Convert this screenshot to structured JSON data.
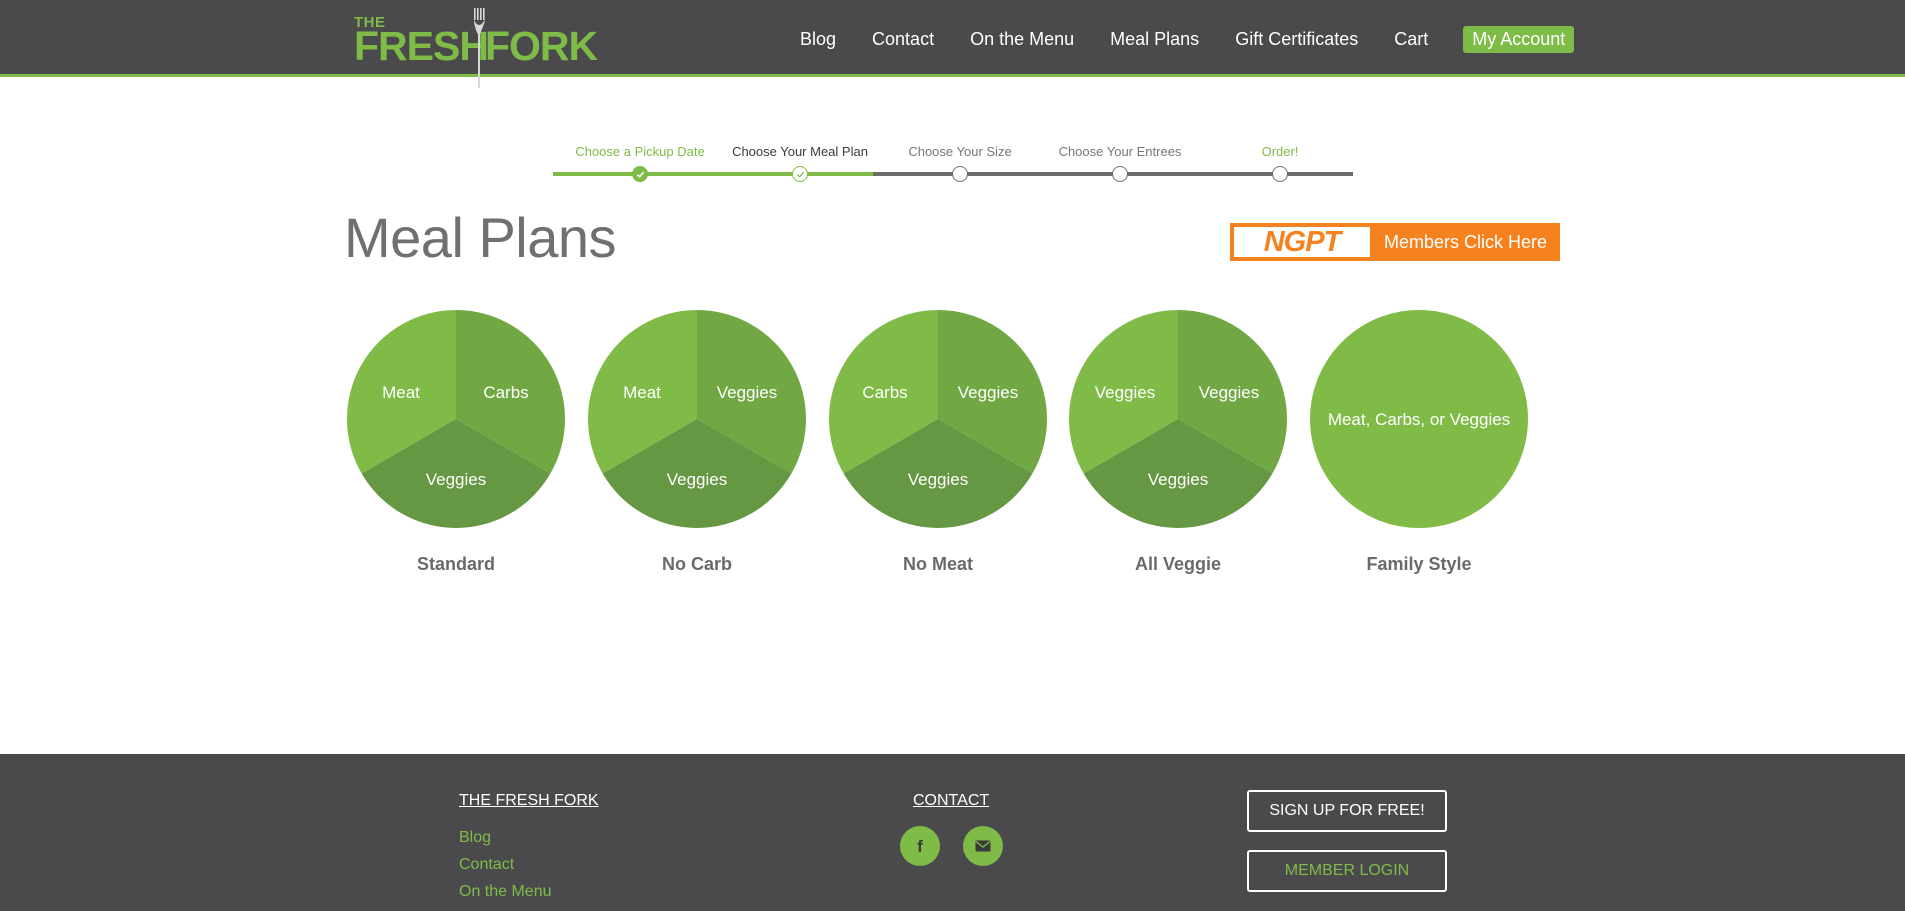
{
  "brand": {
    "top": "THE",
    "word1": "FRESH",
    "word2": "FORK"
  },
  "nav": [
    {
      "label": "Blog"
    },
    {
      "label": "Contact"
    },
    {
      "label": "On the Menu"
    },
    {
      "label": "Meal Plans"
    },
    {
      "label": "Gift Certificates"
    },
    {
      "label": "Cart"
    },
    {
      "label": "My Account"
    }
  ],
  "steps": [
    {
      "label": "Choose a Pickup Date",
      "state": "done"
    },
    {
      "label": "Choose Your Meal Plan",
      "state": "current"
    },
    {
      "label": "Choose Your Size",
      "state": "todo"
    },
    {
      "label": "Choose Your Entrees",
      "state": "todo"
    },
    {
      "label": "Order!",
      "state": "todo"
    }
  ],
  "page_title": "Meal Plans",
  "ngpt": {
    "logo": "NGPT",
    "label": "Members Click Here"
  },
  "plans": [
    {
      "name": "Standard",
      "slices": [
        "Meat",
        "Carbs",
        "Veggies"
      ]
    },
    {
      "name": "No Carb",
      "slices": [
        "Meat",
        "Veggies",
        "Veggies"
      ]
    },
    {
      "name": "No Meat",
      "slices": [
        "Carbs",
        "Veggies",
        "Veggies"
      ]
    },
    {
      "name": "All Veggie",
      "slices": [
        "Veggies",
        "Veggies",
        "Veggies"
      ]
    },
    {
      "name": "Family Style",
      "full": "Meat, Carbs, or Veggies"
    }
  ],
  "footer": {
    "brand_heading": "THE FRESH FORK",
    "links": [
      "Blog",
      "Contact",
      "On the Menu"
    ],
    "contact_heading": "CONTACT",
    "signup_label": "SIGN UP FOR FREE!",
    "login_label": "MEMBER LOGIN"
  },
  "colors": {
    "accent": "#7fbb47",
    "slice_a": "#80bb48",
    "slice_b": "#71a843",
    "slice_c": "#669742",
    "header_bg": "#4a4a4c",
    "ngpt_orange": "#f5821f",
    "track_grey": "#6c6c6c"
  },
  "icons": {
    "fork": "fork-icon",
    "check": "check-icon",
    "facebook": "facebook-icon",
    "email": "email-icon"
  }
}
